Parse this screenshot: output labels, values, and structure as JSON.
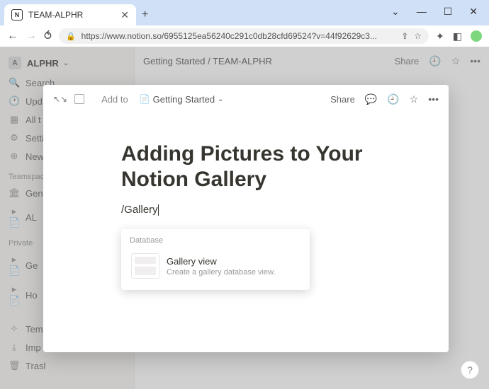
{
  "browser": {
    "tab_title": "TEAM-ALPHR",
    "url": "https://www.notion.so/6955125ea56240c291c0db28cfd69524?v=44f92629c3..."
  },
  "sidebar": {
    "workspace": "ALPHR",
    "workspace_initial": "A",
    "items": [
      {
        "icon": "🔍",
        "label": "Search"
      },
      {
        "icon": "🕐",
        "label": "Upd"
      },
      {
        "icon": "▦",
        "label": "All t"
      },
      {
        "icon": "⚙",
        "label": "Setti"
      },
      {
        "icon": "⊕",
        "label": "New"
      }
    ],
    "section_teamspaces": "Teamspace",
    "teamspaces": [
      {
        "icon": "🏛",
        "label": "Gen"
      },
      {
        "icon": "▸ 📄",
        "label": "AL"
      }
    ],
    "section_private": "Private",
    "private_items": [
      {
        "icon": "▸ 📄",
        "label": "Ge"
      },
      {
        "icon": "▸ 📄",
        "label": "Ho"
      }
    ],
    "bottom_items": [
      {
        "icon": "✧",
        "label": "Tem"
      },
      {
        "icon": "⤓",
        "label": "Imp"
      },
      {
        "icon": "🗑",
        "label": "Trasl"
      }
    ]
  },
  "topbar": {
    "breadcrumb1": "Getting Started",
    "breadcrumb_sep": " / ",
    "breadcrumb2": "TEAM-ALPHR",
    "share": "Share"
  },
  "modal": {
    "addto_label": "Add to",
    "dest_page": "Getting Started",
    "share": "Share",
    "title": "Adding Pictures to Your Notion Gallery",
    "slash_text": "/Gallery"
  },
  "menu": {
    "section": "Database",
    "option": {
      "title": "Gallery view",
      "desc": "Create a gallery database view."
    }
  },
  "help": "?"
}
